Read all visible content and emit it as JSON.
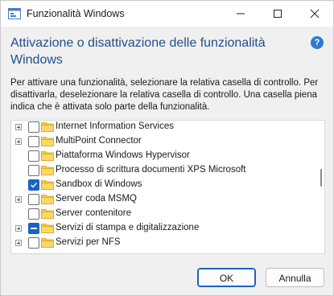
{
  "window": {
    "title": "Funzionalità Windows"
  },
  "header": {
    "heading": "Attivazione o disattivazione delle funzionalità Windows",
    "help_icon": "help-icon"
  },
  "description": "Per attivare una funzionalità, selezionare la relativa casella di controllo. Per disattivarla, deselezionare la relativa casella di controllo. Una casella piena indica che è attivata solo parte della funzionalità.",
  "features": [
    {
      "label": "Internet Information Services",
      "expandable": true,
      "state": "unchecked"
    },
    {
      "label": "MultiPoint Connector",
      "expandable": true,
      "state": "unchecked"
    },
    {
      "label": "Piattaforma Windows Hypervisor",
      "expandable": false,
      "state": "unchecked"
    },
    {
      "label": "Processo di scrittura documenti XPS Microsoft",
      "expandable": false,
      "state": "unchecked"
    },
    {
      "label": "Sandbox di Windows",
      "expandable": false,
      "state": "checked"
    },
    {
      "label": "Server coda MSMQ",
      "expandable": true,
      "state": "unchecked"
    },
    {
      "label": "Server contenitore",
      "expandable": false,
      "state": "unchecked"
    },
    {
      "label": "Servizi di stampa e digitalizzazione",
      "expandable": true,
      "state": "partial"
    },
    {
      "label": "Servizi per NFS",
      "expandable": true,
      "state": "unchecked"
    }
  ],
  "buttons": {
    "ok": "OK",
    "cancel": "Annulla"
  },
  "colors": {
    "heading": "#1f4e8c",
    "accent": "#1a62c4",
    "folder": "#f4c542"
  }
}
